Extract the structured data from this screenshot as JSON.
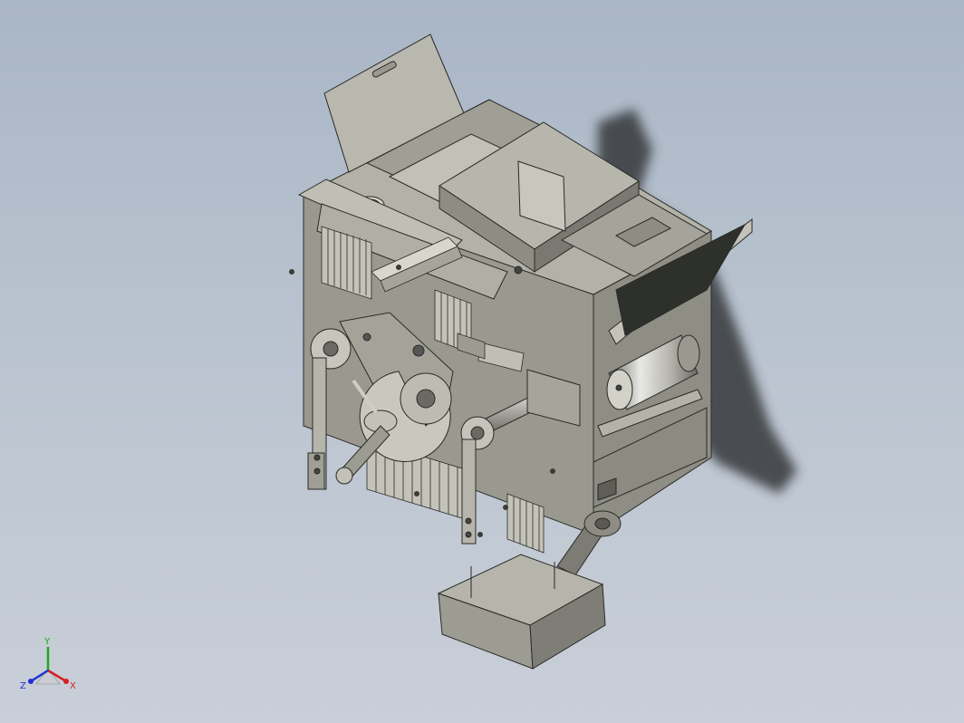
{
  "viewport": {
    "background_top": "#a9b6c6",
    "background_bottom": "#c9cfd8"
  },
  "model": {
    "name_icon": "industrial-packaging-machine-3d",
    "body_color": "#a8a79c",
    "body_shade": "#8a897f",
    "body_dark": "#5e5d56",
    "edge_color": "#2a2a28",
    "shadow_color": "#3a3d40",
    "panel_dark": "#2e302c"
  },
  "triad": {
    "x_label": "X",
    "y_label": "Y",
    "z_label": "Z",
    "x_color": "#d62020",
    "y_color": "#1fa51f",
    "z_color": "#2030d0"
  }
}
